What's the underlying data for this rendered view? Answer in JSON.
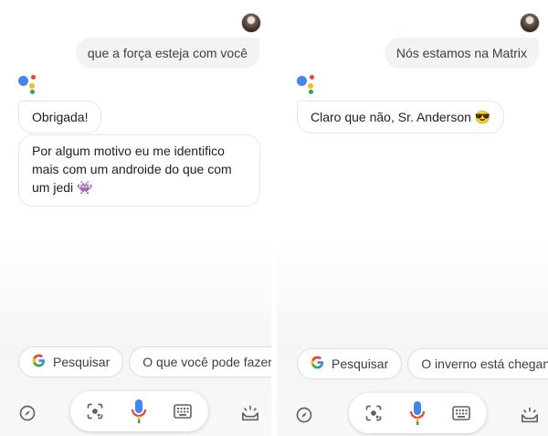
{
  "left": {
    "user_message": "que a força esteja com você",
    "assistant_messages": [
      "Obrigada!",
      "Por algum motivo eu me identifico mais com um androide do que com um jedi 👾"
    ],
    "chips": [
      "Pesquisar",
      "O que você pode fazer?"
    ]
  },
  "right": {
    "user_message": "Nós estamos na Matrix",
    "assistant_messages": [
      "Claro que não, Sr. Anderson 😎"
    ],
    "chips": [
      "Pesquisar",
      "O inverno está chegando"
    ]
  },
  "icons": {
    "explore": "compass-icon",
    "lens": "lens-icon",
    "mic": "mic-icon",
    "keyboard": "keyboard-icon",
    "updates": "updates-icon",
    "chip_logo": "google-g-icon"
  },
  "colors": {
    "google_blue": "#4285f4",
    "google_red": "#ea4335",
    "google_yellow": "#fbbc05",
    "google_green": "#34a853"
  }
}
